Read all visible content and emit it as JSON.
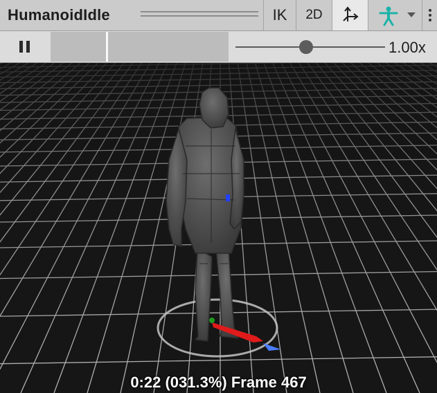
{
  "header": {
    "title": "HumanoidIdle",
    "ik_label": "IK",
    "mode_2d_label": "2D"
  },
  "icons": {
    "pivot": "pivot-axes-icon",
    "avatar": "humanoid-avatar-icon",
    "dropdown": "chevron-down-icon",
    "more": "more-options-icon",
    "pause": "pause-icon"
  },
  "playback": {
    "speed_label": "1.00x",
    "speed_value": 1.0,
    "timeline_position": 0.313
  },
  "viewport": {
    "status_text": "0:22 (031.3%) Frame 467"
  },
  "colors": {
    "header_bg": "#cbcbcb",
    "avatar_accent": "#1bb3a8",
    "axis_x": "#e01b1b",
    "axis_y": "#1f9a1f",
    "axis_z": "#4a7dff",
    "grid": "#d8d8d8"
  }
}
